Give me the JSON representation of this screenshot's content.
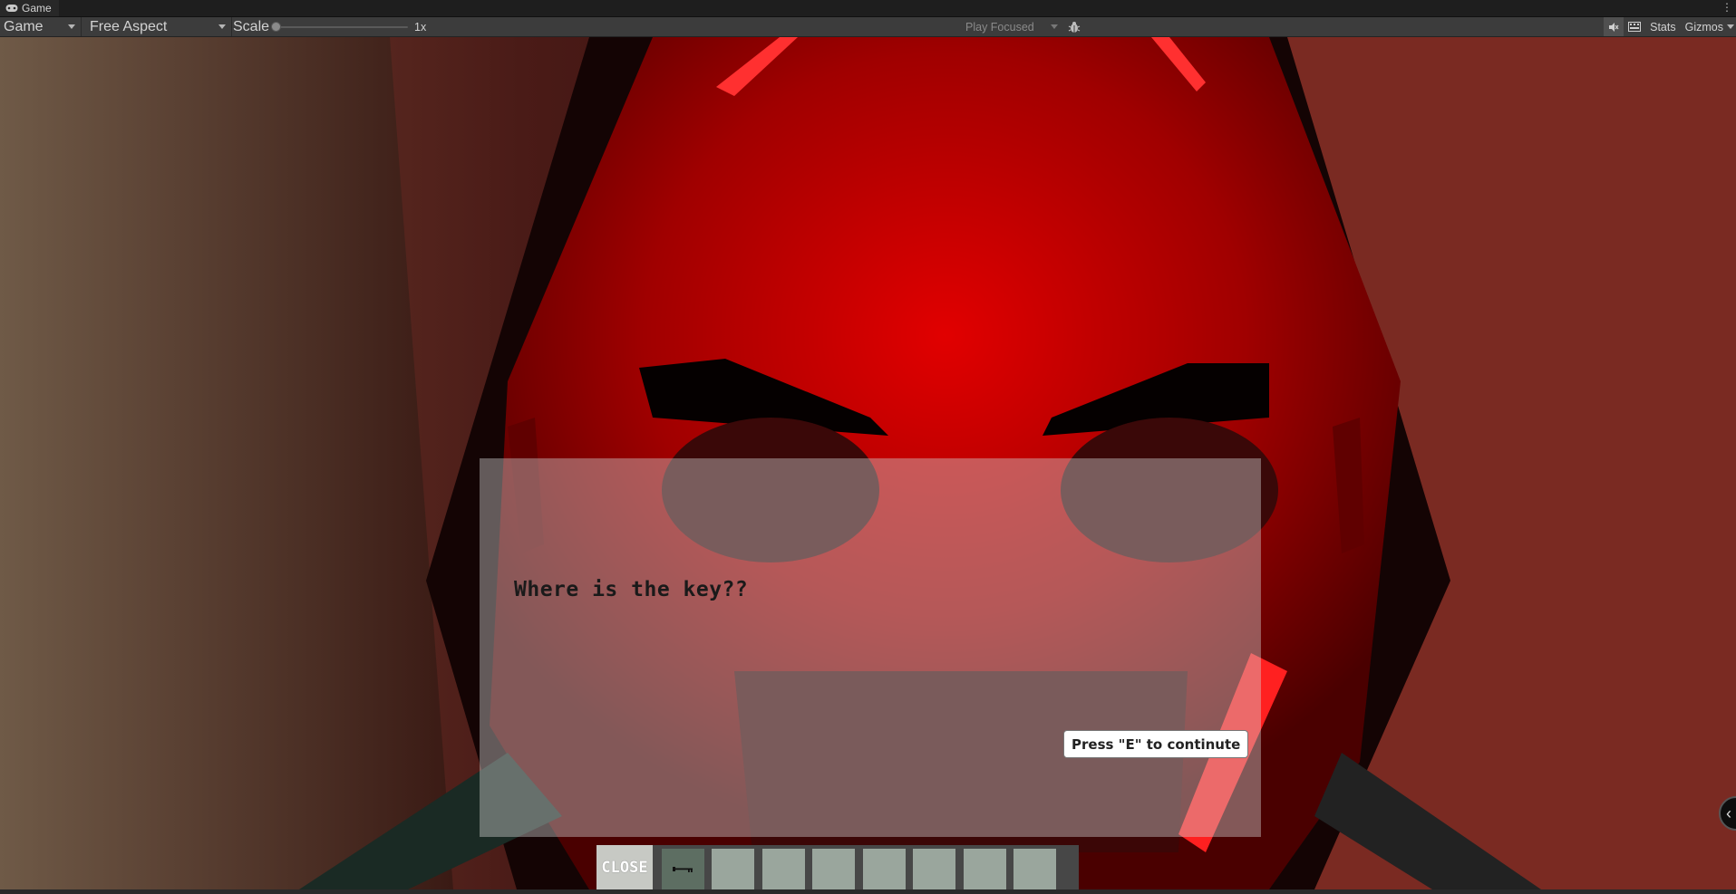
{
  "tab": {
    "title": "Game",
    "icon": "gamepad-icon"
  },
  "toolbar": {
    "view_dropdown": "Game",
    "aspect_dropdown": "Free Aspect",
    "scale_label": "Scale",
    "scale_value": "1x",
    "scale_level": 0.0,
    "play_mode_dropdown": "Play Focused",
    "stats_label": "Stats",
    "gizmos_label": "Gizmos"
  },
  "dialog": {
    "text": "Where is the key??",
    "continue_label": "Press \"E\" to continute"
  },
  "hotbar": {
    "close_label": "CLOSE",
    "slots": [
      {
        "item": "key-icon",
        "selected": true
      },
      {
        "item": null
      },
      {
        "item": null
      },
      {
        "item": null
      },
      {
        "item": null
      },
      {
        "item": null
      },
      {
        "item": null
      },
      {
        "item": null
      }
    ]
  },
  "colors": {
    "mask_red": "#e00000",
    "mask_dark": "#7a0000",
    "dialog_overlay": "rgba(210,210,210,0.42)",
    "slot": "#9aa69d",
    "slot_selected": "#5d6e62"
  }
}
